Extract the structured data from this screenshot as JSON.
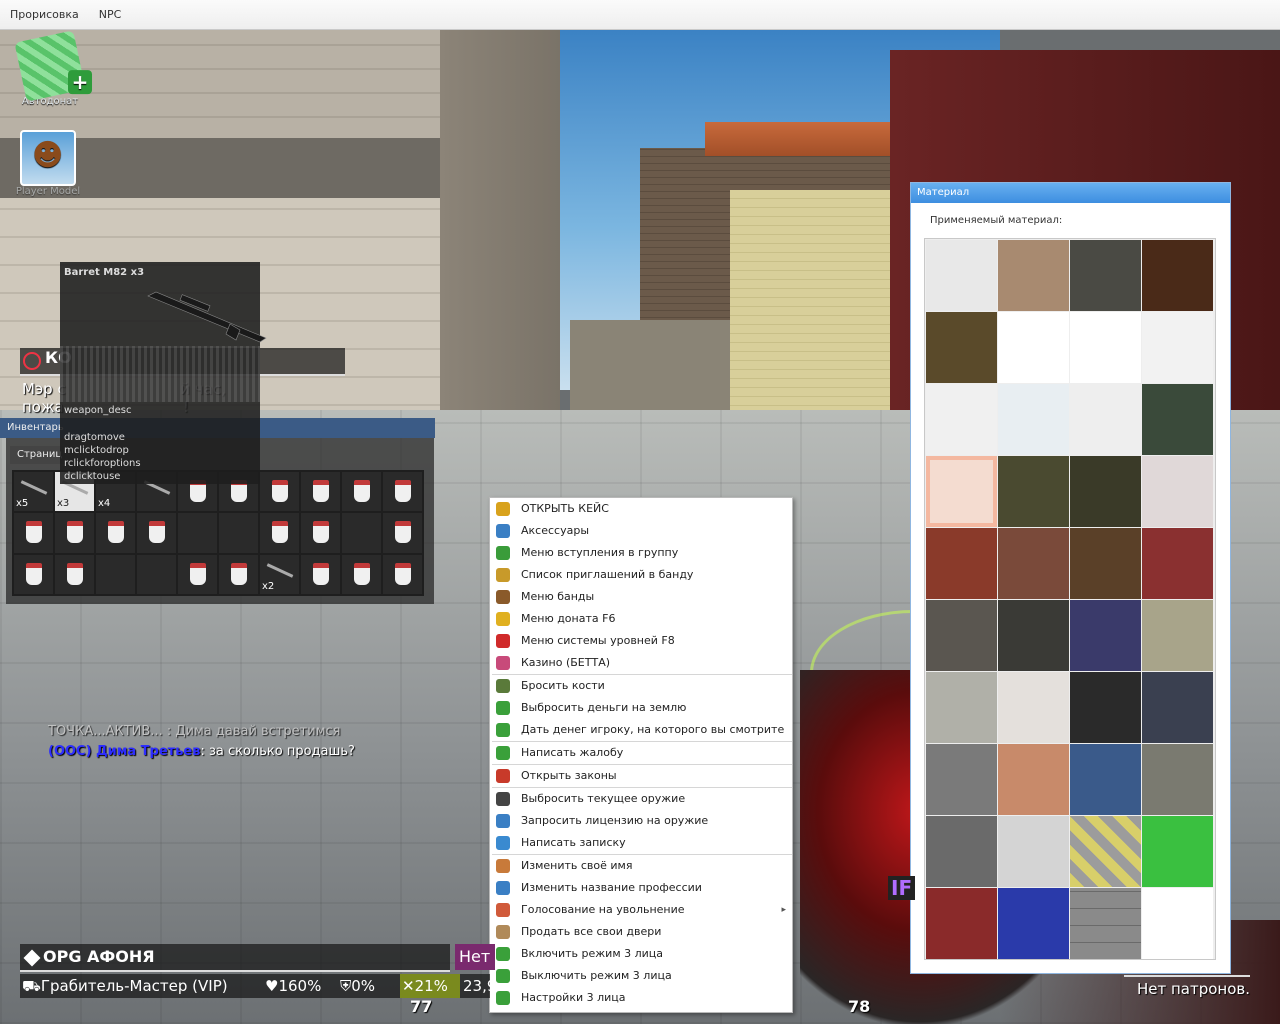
{
  "menubar": {
    "items": [
      "Прорисовка",
      "NPC"
    ]
  },
  "icons": {
    "autodonat": "Автодонат",
    "player_model": "Player Model"
  },
  "tooltip": {
    "title": "Barret M82 x3",
    "desc": "weapon_desc",
    "lines": [
      "dragtomove",
      "mclicktodrop",
      "rclickforoptions",
      "dclicktouse"
    ]
  },
  "announce": {
    "head": "КО",
    "line1": "Мэр с                        й час,",
    "line2": "пожа                         !"
  },
  "chat": {
    "line1_name": "ТОЧКА...АКТИВ...",
    "line1_msg": ": Дима давай встретимся",
    "line2_ooc": "(OOC) Дима Третьев",
    "line2_msg": ": за сколько продашь?"
  },
  "inventory": {
    "title": "Инвентарь",
    "tab": "Страниц",
    "counts": {
      "s0": "x5",
      "s1": "x3",
      "s2": "x4",
      "s26": "x2"
    }
  },
  "context_menu": {
    "groups": [
      [
        {
          "label": "ОТКРЫТЬ КЕЙС",
          "icon": "case-icon",
          "color": "#d8a21c"
        },
        {
          "label": "Аксессуары",
          "icon": "accessories-icon",
          "color": "#3a7fc4"
        },
        {
          "label": "Меню вступления в группу",
          "icon": "group-icon",
          "color": "#3a9c3a"
        },
        {
          "label": "Список приглашений в банду",
          "icon": "invite-icon",
          "color": "#c89a2a"
        },
        {
          "label": "Меню банды",
          "icon": "gang-icon",
          "color": "#8a5a2a"
        },
        {
          "label": "Меню доната F6",
          "icon": "coins-icon",
          "color": "#e0b020"
        },
        {
          "label": "Меню системы уровней F8",
          "icon": "ribbon-icon",
          "color": "#d02a2a"
        },
        {
          "label": "Казино (БЕТТА)",
          "icon": "casino-icon",
          "color": "#c84a7a"
        }
      ],
      [
        {
          "label": "Бросить кости",
          "icon": "dice-icon",
          "color": "#5a7a3a"
        },
        {
          "label": "Выбросить деньги на землю",
          "icon": "money-drop-icon",
          "color": "#3aa03a"
        },
        {
          "label": "Дать денег игроку, на которого вы смотрите",
          "icon": "money-give-icon",
          "color": "#3aa03a"
        }
      ],
      [
        {
          "label": "Написать жалобу",
          "icon": "complaint-icon",
          "color": "#3aa03a"
        }
      ],
      [
        {
          "label": "Открыть законы",
          "icon": "calendar-icon",
          "color": "#c83a2a"
        }
      ],
      [
        {
          "label": "Выбросить текущее оружие",
          "icon": "pistol-icon",
          "color": "#444444"
        },
        {
          "label": "Запросить лицензию на оружие",
          "icon": "license-icon",
          "color": "#3a7fc4"
        },
        {
          "label": "Написать записку",
          "icon": "note-icon",
          "color": "#3a8ad0"
        }
      ],
      [
        {
          "label": "Изменить своё имя",
          "icon": "user-edit-icon",
          "color": "#c87a3a"
        },
        {
          "label": "Изменить название профессии",
          "icon": "user-job-icon",
          "color": "#3a7fc4"
        },
        {
          "label": "Голосование на увольнение",
          "icon": "user-vote-icon",
          "color": "#d05a3a",
          "submenu": true
        },
        {
          "label": "Продать все свои двери",
          "icon": "door-icon",
          "color": "#b08a5a"
        },
        {
          "label": "Включить режим 3 лица",
          "icon": "view-on-icon",
          "color": "#3aa03a"
        },
        {
          "label": "Выключить режим 3 лица",
          "icon": "view-off-icon",
          "color": "#3aa03a"
        },
        {
          "label": "Настройки 3 лица",
          "icon": "view-settings-icon",
          "color": "#3aa03a"
        }
      ]
    ]
  },
  "material_panel": {
    "title": "Материал",
    "label": "Применяемый материал:",
    "textures": [
      "#e8e8e8",
      "#a88a70",
      "#4a4a44",
      "#4a2a18",
      "#5a4a2a",
      "#ffffff",
      "#ffffff",
      "#f2f2f2",
      "#f0f0f0",
      "#e8eef2",
      "#eeeeee",
      "#3a4a3a",
      "#f4dcd0",
      "#4a4a30",
      "#3a3a28",
      "#e0d8d8",
      "#8a3a2a",
      "#7a4a3a",
      "#5a4028",
      "#8a3030",
      "#5a5650",
      "#3a3a36",
      "#3a3a6a",
      "#a8a48a",
      "#b0b0a8",
      "#e4e0dc",
      "#2a2a2a",
      "#3a4050",
      "#7a7a7a",
      "#c88a6a",
      "#3a5a8a",
      "#7a7a70",
      "#6a6a6a",
      "#d4d4d4",
      "#a8a080",
      "#3ac040",
      "#8a2a2a",
      "#2a3aaa",
      "#8a8a8a",
      "#ffffff"
    ]
  },
  "hud": {
    "name": "OPG АФОНЯ",
    "net": "Нет",
    "job": "⛟Грабитель-Мастер (VIP)",
    "hp": "♥160%",
    "armor": "⛨0%",
    "food": "✕21%",
    "money": "23,9",
    "ammo_left": "77",
    "ammo_right": "78",
    "no_ammo": "Нет патронов.",
    "badge": "IF"
  }
}
